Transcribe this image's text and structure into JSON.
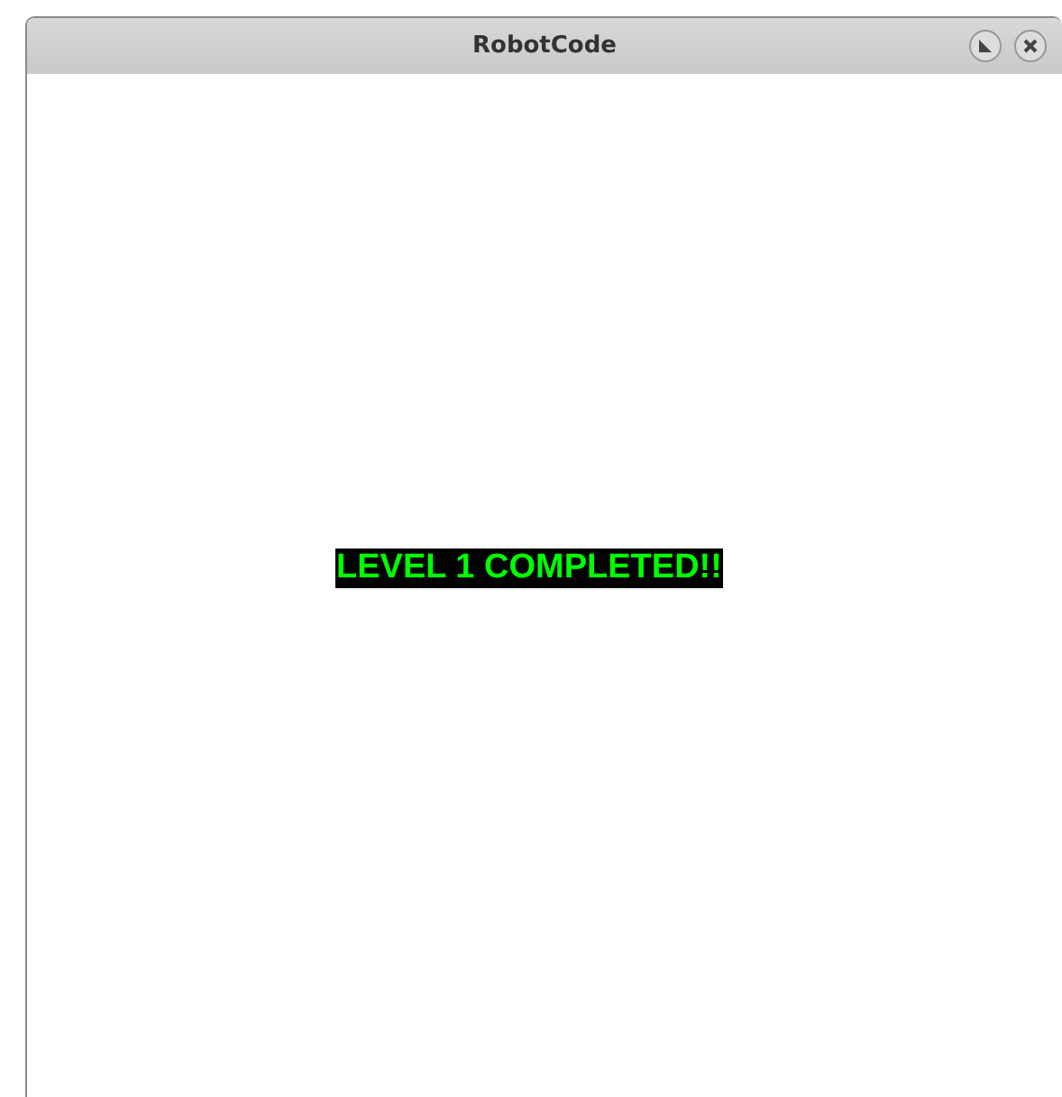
{
  "window": {
    "title": "RobotCode"
  },
  "message": {
    "text": "LEVEL 1 COMPLETED!!"
  }
}
